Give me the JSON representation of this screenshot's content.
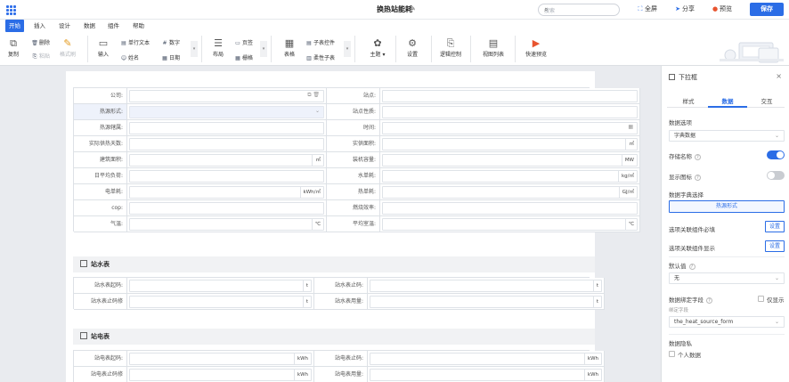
{
  "header": {
    "title": "换热站能耗",
    "search_placeholder": "搜索",
    "fullscreen": "全屏",
    "share": "分享",
    "preview": "预览",
    "save": "保存"
  },
  "menu_tabs": [
    "开始",
    "插入",
    "设计",
    "数据",
    "组件",
    "帮助"
  ],
  "ribbon": {
    "copy": "复制",
    "delete": "删除",
    "paste": "粘贴",
    "format_painter": "格式刷",
    "input": "输入",
    "single_line": "单行文本",
    "number": "数字",
    "name": "姓名",
    "date": "日期",
    "layout": "布局",
    "page": "页签",
    "grid": "栅格",
    "table": "表格",
    "subtable_ctrl": "子表控件",
    "pattern_sub": "柔性子表",
    "theme": "主题",
    "settings": "设置",
    "logic": "逻辑控制",
    "view_list": "视图列表",
    "quick_preview": "快速预览"
  },
  "form": {
    "rows": [
      {
        "l1": "公司:",
        "u1": "",
        "l2": "站点:",
        "u2": ""
      },
      {
        "l1": "热源形式:",
        "u1": "",
        "l2": "站点性质:",
        "u2": ""
      },
      {
        "l1": "热源辖属:",
        "u1": "",
        "l2": "时间:",
        "u2": ""
      },
      {
        "l1": "实际供热天数:",
        "u1": "",
        "l2": "实供面积:",
        "u2": "㎡"
      },
      {
        "l1": "建筑面积:",
        "u1": "㎡",
        "l2": "装机容量:",
        "u2": "MW"
      },
      {
        "l1": "日平均负荷:",
        "u1": "",
        "l2": "水单耗:",
        "u2": "kg/㎡"
      },
      {
        "l1": "电单耗:",
        "u1": "kWh/㎡",
        "l2": "热单耗:",
        "u2": "GJ/㎡"
      },
      {
        "l1": "cop:",
        "u1": "",
        "l2": "燃烧效率:",
        "u2": ""
      },
      {
        "l1": "气温:",
        "u1": "℃",
        "l2": "平均室温:",
        "u2": "℃"
      }
    ]
  },
  "sections": [
    {
      "title": "站水表",
      "rows": [
        {
          "l1": "站水表起码:",
          "u1": "t",
          "l2": "站水表止码:",
          "u2": "t"
        },
        {
          "l1": "站水表止码修",
          "u1": "t",
          "l2": "站水表用量:",
          "u2": "t"
        }
      ]
    },
    {
      "title": "站电表",
      "rows": [
        {
          "l1": "站电表起码:",
          "u1": "kWh",
          "l2": "站电表止码:",
          "u2": "kWh"
        },
        {
          "l1": "站电表止码修",
          "u1": "kWh",
          "l2": "站电表用量:",
          "u2": "kWh"
        }
      ]
    }
  ],
  "panel": {
    "title": "下拉框",
    "tabs": [
      "样式",
      "数据",
      "交互"
    ],
    "options_label": "数据选项",
    "options_value": "字典数据",
    "store_name": "存储名称",
    "show_icon": "显示图标",
    "dict_select": "数据字典选择",
    "dict_value": "热源形式",
    "linked_required": "选项关联组件必填",
    "linked_show": "选项关联组件显示",
    "set_btn": "设置",
    "default_label": "默认值",
    "default_value": "无",
    "bind_label": "数据绑定字段",
    "show_only": "仅显示",
    "bind_sublabel": "绑定字段",
    "bind_value": "the_heat_source_form",
    "privacy_label": "数据隐私",
    "personal_data": "个人数据"
  },
  "colors": {
    "accent": "#2b6de6",
    "highlight_row": "#eef2fb"
  }
}
